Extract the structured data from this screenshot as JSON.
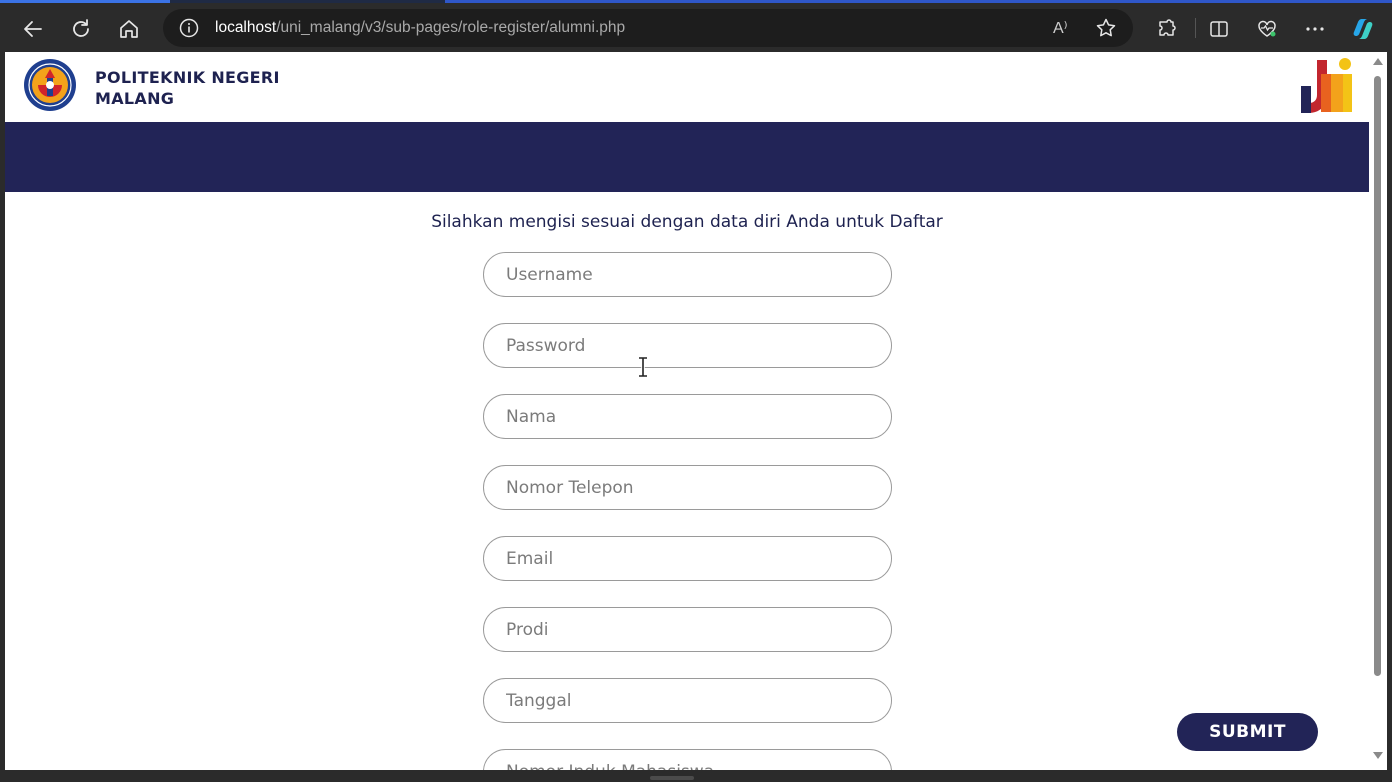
{
  "browser": {
    "url_host": "localhost",
    "url_path": "/uni_malang/v3/sub-pages/role-register/alumni.php",
    "read_aloud_label": "A⁾",
    "icons": [
      "back-icon",
      "refresh-icon",
      "home-icon",
      "info-icon",
      "read-aloud-icon",
      "favorite-icon",
      "extensions-icon",
      "split-screen-icon",
      "health-icon",
      "more-icon",
      "copilot-icon"
    ]
  },
  "header": {
    "institution_line1": "POLITEKNIK NEGERI",
    "institution_line2": "MALANG",
    "brand_color": "#222457"
  },
  "form": {
    "intro": "Silahkan mengisi sesuai dengan data diri Anda untuk Daftar",
    "fields": [
      {
        "placeholder": "Username",
        "value": ""
      },
      {
        "placeholder": "Password",
        "value": ""
      },
      {
        "placeholder": "Nama",
        "value": ""
      },
      {
        "placeholder": "Nomor Telepon",
        "value": ""
      },
      {
        "placeholder": "Email",
        "value": ""
      },
      {
        "placeholder": "Prodi",
        "value": ""
      },
      {
        "placeholder": "Tanggal",
        "value": ""
      },
      {
        "placeholder": "Nomor Induk Mahasiswa",
        "value": ""
      }
    ],
    "submit_label": "SUBMIT"
  }
}
